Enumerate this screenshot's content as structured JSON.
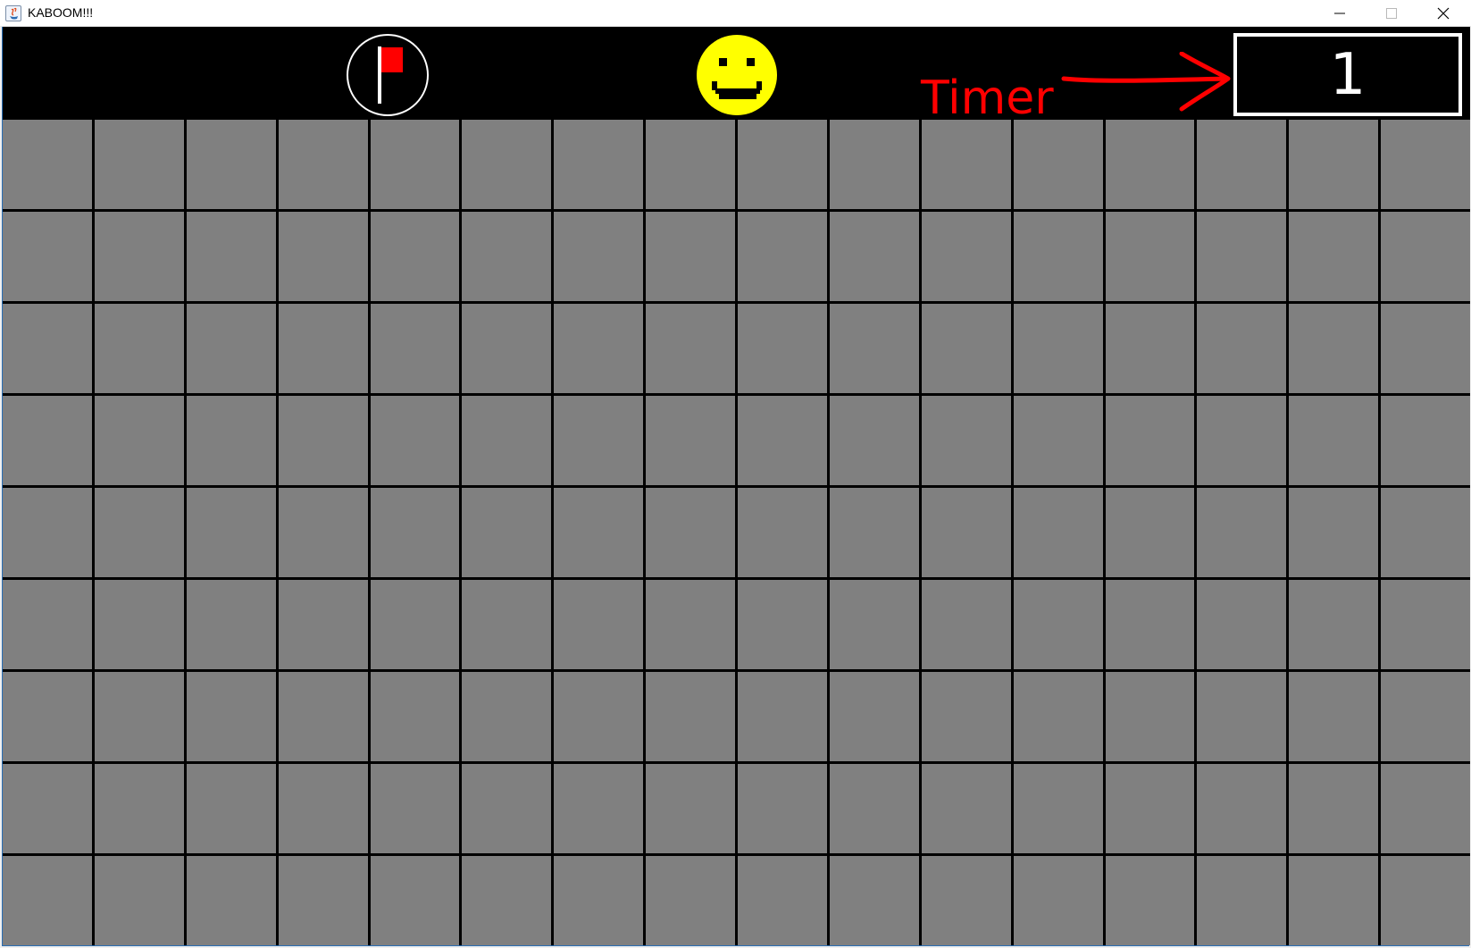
{
  "window": {
    "title": "KABOOM!!!",
    "controls": [
      "minimize-icon",
      "maximize-icon",
      "close-icon"
    ]
  },
  "hud": {
    "flag_icon": "flag-icon",
    "reset_icon": "smiley-face-icon",
    "annotation": {
      "label": "Timer",
      "color": "#ff0000",
      "icon": "arrow-right-icon"
    },
    "timer": {
      "value": "1"
    }
  },
  "board": {
    "rows": 9,
    "columns": 16,
    "cell_state": "unrevealed",
    "cell_color": "#808080"
  },
  "colors": {
    "hud_background": "#000000",
    "smiley": "#ffff00",
    "flag": "#ff0000"
  }
}
